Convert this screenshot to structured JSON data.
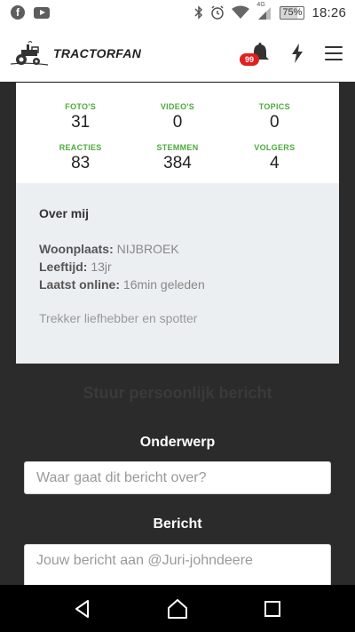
{
  "status_bar": {
    "time": "18:26",
    "battery": "75%",
    "network": "4G",
    "icons": [
      "facebook-icon",
      "youtube-icon",
      "bluetooth-icon",
      "alarm-icon",
      "wifi-icon",
      "signal-icon",
      "battery-icon"
    ]
  },
  "header": {
    "logo_text": "TRACTORFAN",
    "notification_count": "99",
    "icons": [
      "tractor-logo-icon",
      "bell-icon",
      "lightning-icon",
      "menu-icon"
    ]
  },
  "profile": {
    "stats": [
      {
        "label": "FOTO'S",
        "value": "31"
      },
      {
        "label": "VIDEO'S",
        "value": "0"
      },
      {
        "label": "TOPICS",
        "value": "0"
      },
      {
        "label": "REACTIES",
        "value": "83"
      },
      {
        "label": "STEMMEN",
        "value": "384"
      },
      {
        "label": "VOLGERS",
        "value": "4"
      }
    ],
    "about": {
      "title": "Over mij",
      "residence_label": "Woonplaats:",
      "residence_value": "NIJBROEK",
      "age_label": "Leeftijd:",
      "age_value": "13jr",
      "last_online_label": "Laatst online:",
      "last_online_value": "16min geleden",
      "bio": "Trekker liefhebber en spotter"
    }
  },
  "message_form": {
    "title": "Stuur persoonlijk bericht",
    "subject_label": "Onderwerp",
    "subject_placeholder": "Waar gaat dit bericht over?",
    "message_label": "Bericht",
    "message_placeholder": "Jouw bericht aan @Juri-johndeere"
  },
  "colors": {
    "accent_green": "#4caa3c",
    "badge_red": "#e02020",
    "page_bg": "#2b2b2b"
  }
}
